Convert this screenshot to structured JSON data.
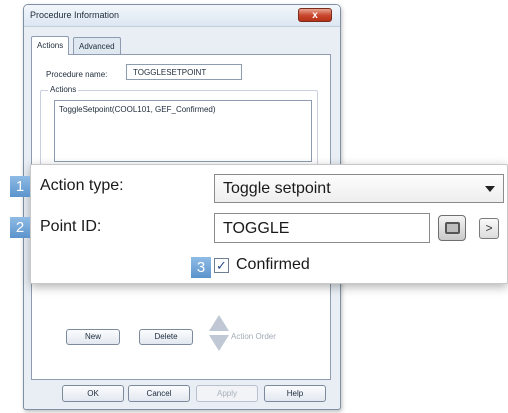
{
  "window": {
    "title": "Procedure Information",
    "close_glyph": "x"
  },
  "tabs": [
    {
      "label": "Actions",
      "active": true
    },
    {
      "label": "Advanced",
      "active": false
    }
  ],
  "procedure": {
    "name_label": "Procedure name:",
    "name_value": "TOGGLESETPOINT"
  },
  "actions_group": {
    "legend": "Actions",
    "items": [
      "ToggleSetpoint(COOL101, GEF_Confirmed)"
    ]
  },
  "list_buttons": {
    "new": "New",
    "delete": "Delete",
    "action_order": "Action Order"
  },
  "dialog_buttons": {
    "ok": "OK",
    "cancel": "Cancel",
    "apply": "Apply",
    "help": "Help"
  },
  "overlay": {
    "action_type": {
      "badge": "1",
      "label": "Action type:",
      "value": "Toggle setpoint"
    },
    "point_id": {
      "badge": "2",
      "label": "Point ID:",
      "value": "TOGGLE",
      "next_glyph": ">"
    },
    "confirmed": {
      "badge": "3",
      "label": "Confirmed",
      "checked": true,
      "check_glyph": "✓"
    }
  },
  "icons": {
    "browse": "point-browser-icon",
    "next": "chevron-right-icon",
    "dropdown": "chevron-down-icon",
    "action_order": "up-down-arrows-icon"
  },
  "colors": {
    "badge": "#6fa4d8",
    "window_bg": "#e9eef5",
    "close": "#c8452b"
  }
}
